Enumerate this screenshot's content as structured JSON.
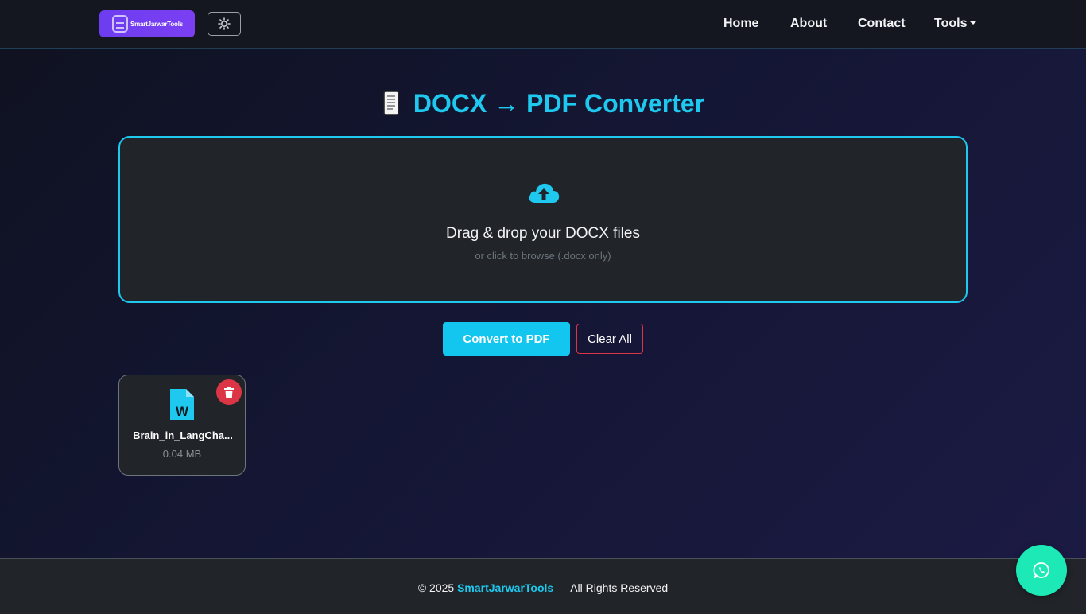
{
  "navbar": {
    "brand": "SmartJarwarTools",
    "links": {
      "home": "Home",
      "about": "About",
      "contact": "Contact",
      "tools": "Tools"
    },
    "icons": {
      "theme_toggle": "gear-icon",
      "tools_caret": "caret-down-icon"
    }
  },
  "page": {
    "title": "DOCX → PDF Converter",
    "title_icon": "document-icon",
    "accent_color": "#1ec8ee"
  },
  "dropzone": {
    "icon": "cloud-upload-icon",
    "title": "Drag & drop your DOCX files",
    "subtitle": "or click to browse (.docx only)"
  },
  "actions": {
    "convert_label": "Convert to PDF",
    "clear_label": "Clear All"
  },
  "files": [
    {
      "icon": "word-file-icon",
      "name": "Brain_in_LangCha...",
      "size": "0.04 MB",
      "delete_icon": "trash-icon"
    }
  ],
  "footer": {
    "prefix": "© 2025 ",
    "brand": "SmartJarwarTools",
    "suffix": " — All Rights Reserved"
  },
  "fab": {
    "icon": "whatsapp-icon"
  },
  "colors": {
    "danger": "#dc3545",
    "brand_purple": "#6d3df0",
    "fab_green": "#1de9b6"
  }
}
